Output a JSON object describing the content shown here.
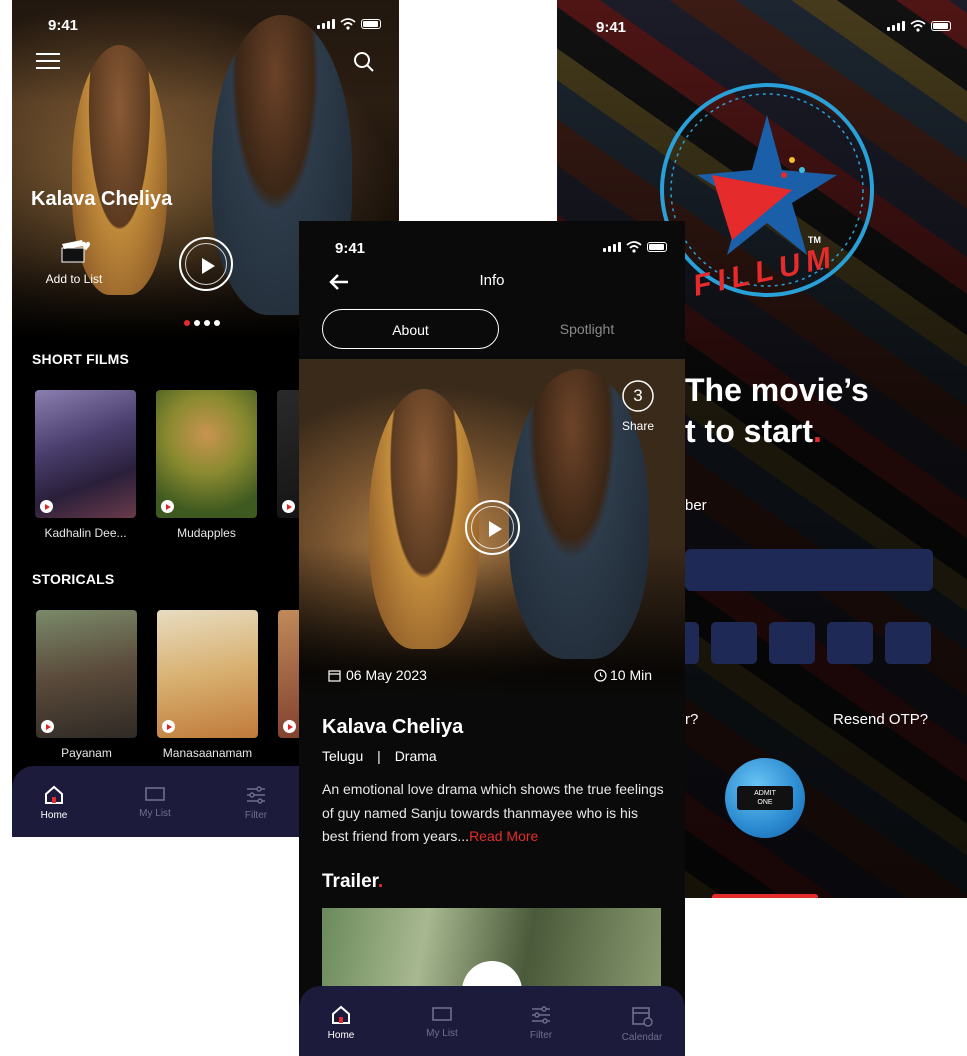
{
  "home": {
    "time": "9:41",
    "hero_title": "Kalava Cheliya",
    "add_to_list": "Add to List",
    "sections": [
      {
        "title": "SHORT FILMS",
        "items": [
          "Kadhalin Dee...",
          "Mudapples"
        ]
      },
      {
        "title": "STORICALS",
        "items": [
          "Payanam",
          "Manasaanamam"
        ]
      }
    ],
    "nav": [
      "Home",
      "My List",
      "Filter"
    ]
  },
  "info": {
    "time": "9:41",
    "header_title": "Info",
    "tabs": [
      "About",
      "Spotlight"
    ],
    "share_count": "3",
    "share_label": "Share",
    "date": "06 May 2023",
    "duration": "10 Min",
    "title": "Kalava Cheliya",
    "language": "Telugu",
    "separator": "|",
    "genre": "Drama",
    "description": "An emotional love drama which shows the true feelings of guy named Sanju towards thanmayee who is his best friend from years...",
    "read_more": "Read More",
    "trailer_title": "Trailer",
    "nav": [
      "Home",
      "My List",
      "Filter",
      "Calendar"
    ]
  },
  "login": {
    "time": "9:41",
    "logo_text": "FILLUM",
    "tm": "TM",
    "headline_line1": "The movie’s",
    "headline_line2": "t to start",
    "field_label_fragment": "ber",
    "resend_left_fragment": "r?",
    "resend_otp": "Resend OTP?",
    "ticket_text_line1": "ADMIT",
    "ticket_text_line2": "ONE"
  },
  "colors": {
    "accent": "#e52b2b",
    "navbar": "#1d1b3b",
    "login_blue": "#1e2a55"
  }
}
